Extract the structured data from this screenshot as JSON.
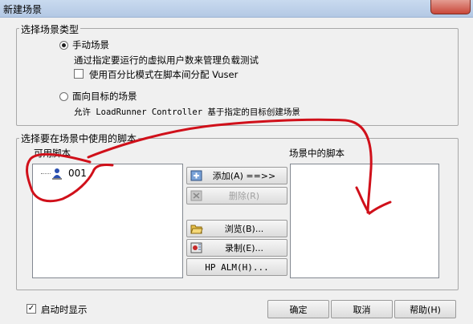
{
  "window": {
    "title": "新建场景"
  },
  "scenario_type": {
    "group_label": "选择场景类型",
    "manual": {
      "label": "手动场景",
      "description": "通过指定要运行的虚拟用户数来管理负载测试",
      "percent_checkbox_label": "使用百分比模式在脚本间分配 Vuser",
      "selected": true
    },
    "goal": {
      "label": "面向目标的场景",
      "description": "允许 LoadRunner Controller 基于指定的目标创建场景",
      "selected": false
    }
  },
  "scripts": {
    "group_label": "选择要在场景中使用的脚本",
    "available_label": "可用脚本",
    "available_items": [
      "001"
    ],
    "scenario_label": "场景中的脚本",
    "scenario_items": []
  },
  "buttons": {
    "add": "添加(A) ==>>",
    "remove": "删除(R)",
    "browse": "浏览(B)...",
    "record": "录制(E)...",
    "hp_alm": "HP ALM(H)...",
    "ok": "确定",
    "cancel": "取消",
    "help": "帮助(H)"
  },
  "footer": {
    "show_on_startup_label": "启动时显示",
    "show_on_startup_checked": true
  },
  "colors": {
    "annotation": "#d0101a"
  }
}
